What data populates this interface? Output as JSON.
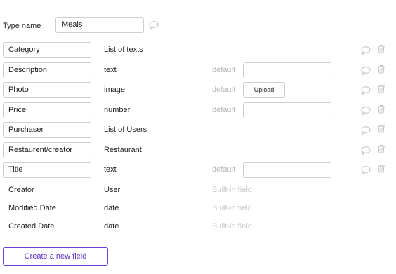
{
  "type": {
    "label": "Type name",
    "value": "Meals"
  },
  "fields": [
    {
      "name": "Category",
      "type": "List of texts",
      "editable": true,
      "default_kind": "none"
    },
    {
      "name": "Description",
      "type": "text",
      "editable": true,
      "default_kind": "input",
      "default_label": "default",
      "default_value": ""
    },
    {
      "name": "Photo",
      "type": "image",
      "editable": true,
      "default_kind": "upload",
      "default_label": "default",
      "upload_label": "Upload"
    },
    {
      "name": "Price",
      "type": "number",
      "editable": true,
      "default_kind": "input",
      "default_label": "default",
      "default_value": ""
    },
    {
      "name": "Purchaser",
      "type": "List of Users",
      "editable": true,
      "default_kind": "none"
    },
    {
      "name": "Restaurent/creator",
      "type": "Restaurant",
      "editable": true,
      "default_kind": "none"
    },
    {
      "name": "Title",
      "type": "text",
      "editable": true,
      "default_kind": "input",
      "default_label": "default",
      "default_value": ""
    },
    {
      "name": "Creator",
      "type": "User",
      "editable": false,
      "default_kind": "builtin",
      "builtin_label": "Built-in field"
    },
    {
      "name": "Modified Date",
      "type": "date",
      "editable": false,
      "default_kind": "builtin",
      "builtin_label": "Built-in field"
    },
    {
      "name": "Created Date",
      "type": "date",
      "editable": false,
      "default_kind": "builtin",
      "builtin_label": "Built-in field"
    }
  ],
  "actions": {
    "create_field_label": "Create a new field"
  },
  "icons": {
    "comment": "speech-bubble-icon",
    "delete": "trash-icon"
  },
  "colors": {
    "accent": "#5b2fc9",
    "icon": "#c4c4c4",
    "muted_text": "#b7b7b7"
  }
}
